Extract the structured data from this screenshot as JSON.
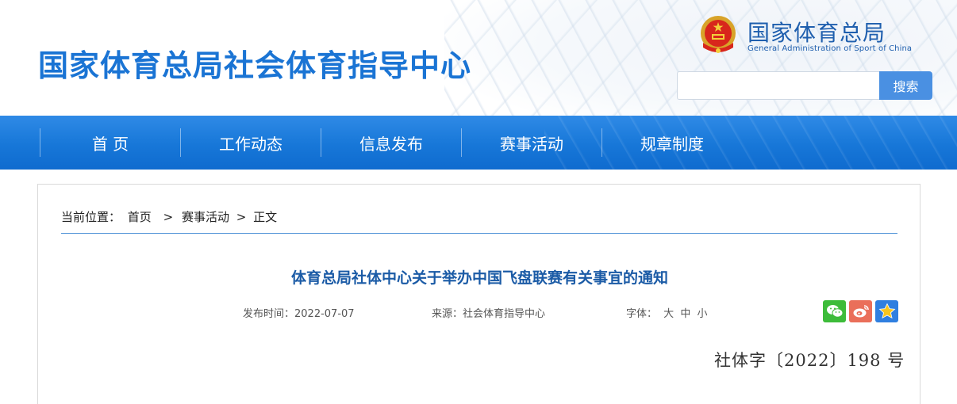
{
  "header": {
    "site_title": "国家体育总局社会体育指导中心",
    "brand_cn": "国家体育总局",
    "brand_en": "General Administration of Sport of China",
    "search_button": "搜索",
    "search_value": ""
  },
  "nav": {
    "items": [
      {
        "label": "首 页"
      },
      {
        "label": "工作动态"
      },
      {
        "label": "信息发布"
      },
      {
        "label": "赛事活动"
      },
      {
        "label": "规章制度"
      }
    ]
  },
  "breadcrumb": {
    "prefix": "当前位置：",
    "home": "首页",
    "sep1": ">",
    "section": "赛事活动",
    "sep2": ">",
    "current": "正文"
  },
  "article": {
    "title": "体育总局社体中心关于举办中国飞盘联赛有关事宜的通知",
    "date_label": "发布时间：2022-07-07",
    "source_label": "来源：社会体育指导中心",
    "font_label": "字体：",
    "font_sizes": [
      "大",
      "中",
      "小"
    ],
    "doc_number": "社体字〔2022〕198 号"
  },
  "share": {
    "icons": [
      "wechat-icon",
      "weibo-icon",
      "qzone-icon"
    ]
  },
  "colors": {
    "primary": "#1a74d4",
    "nav_bg": "#1777d8",
    "title": "#1b5ba6",
    "wechat": "#3dbc3a",
    "weibo": "#ea6f5a",
    "qzone": "#2f7fe0"
  }
}
